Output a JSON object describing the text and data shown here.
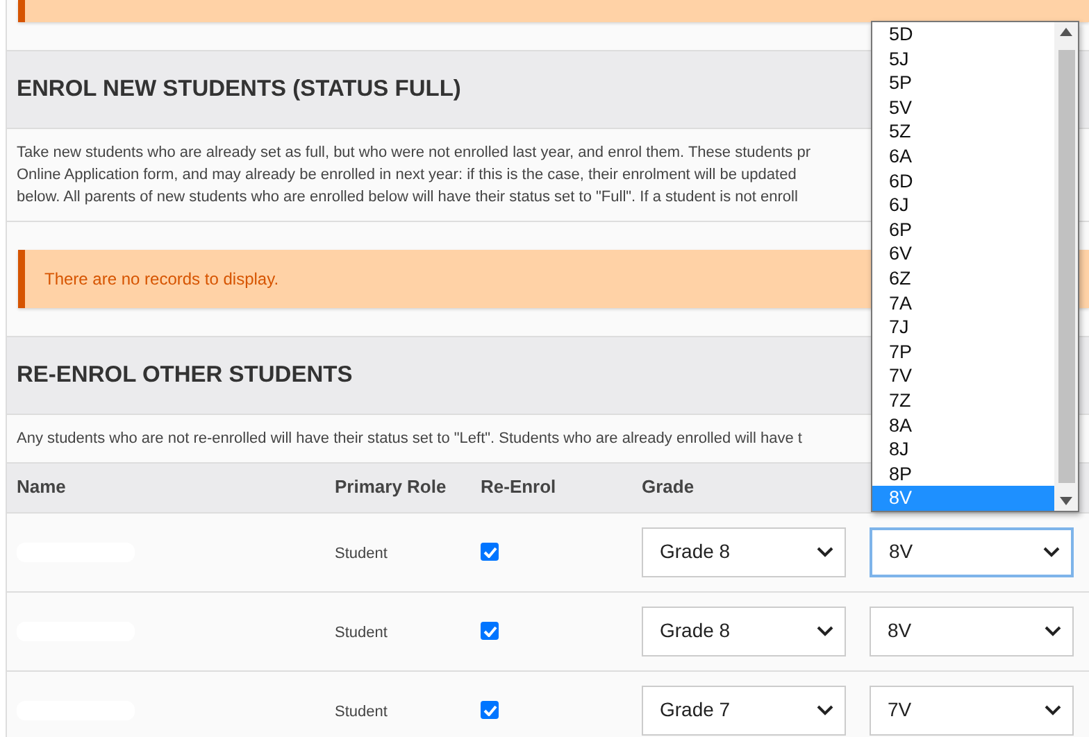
{
  "sections": [
    {
      "kind": "alert"
    },
    {
      "kind": "heading",
      "text": "ENROL NEW STUDENTS (STATUS FULL)"
    },
    {
      "kind": "paragraph",
      "lines": [
        "Take new students who are already set as full, but who were not enrolled last year, and enrol them. These students pr",
        "Online Application form, and may already be enrolled in next year: if this is the case, their enrolment will be updated",
        "below. All parents of new students who are enrolled below will have their status set to \"Full\". If a student is not enroll"
      ]
    },
    {
      "kind": "alert",
      "text": "There are no records to display."
    },
    {
      "kind": "heading",
      "text": "RE-ENROL OTHER STUDENTS"
    },
    {
      "kind": "paragraph",
      "lines": [
        "Any students who are not re-enrolled will have their status set to \"Left\". Students who are already enrolled will have t"
      ]
    }
  ],
  "table": {
    "columns": [
      "Name",
      "Primary Role",
      "Re-Enrol",
      "Grade"
    ],
    "rows": [
      {
        "role": "Student",
        "re_enrol": true,
        "grade": "Grade 8",
        "class": "8V",
        "focused": true
      },
      {
        "role": "Student",
        "re_enrol": true,
        "grade": "Grade 8",
        "class": "8V",
        "focused": false
      },
      {
        "role": "Student",
        "re_enrol": true,
        "grade": "Grade 7",
        "class": "7V",
        "focused": false
      }
    ]
  },
  "open_dropdown": {
    "options": [
      {
        "label": "5D",
        "selected": false
      },
      {
        "label": "5J",
        "selected": false
      },
      {
        "label": "5P",
        "selected": false
      },
      {
        "label": "5V",
        "selected": false
      },
      {
        "label": "5Z",
        "selected": false
      },
      {
        "label": "6A",
        "selected": false
      },
      {
        "label": "6D",
        "selected": false
      },
      {
        "label": "6J",
        "selected": false
      },
      {
        "label": "6P",
        "selected": false
      },
      {
        "label": "6V",
        "selected": false
      },
      {
        "label": "6Z",
        "selected": false
      },
      {
        "label": "7A",
        "selected": false
      },
      {
        "label": "7J",
        "selected": false
      },
      {
        "label": "7P",
        "selected": false
      },
      {
        "label": "7V",
        "selected": false
      },
      {
        "label": "7Z",
        "selected": false
      },
      {
        "label": "8A",
        "selected": false
      },
      {
        "label": "8J",
        "selected": false
      },
      {
        "label": "8P",
        "selected": false
      },
      {
        "label": "8V",
        "selected": true
      }
    ]
  }
}
